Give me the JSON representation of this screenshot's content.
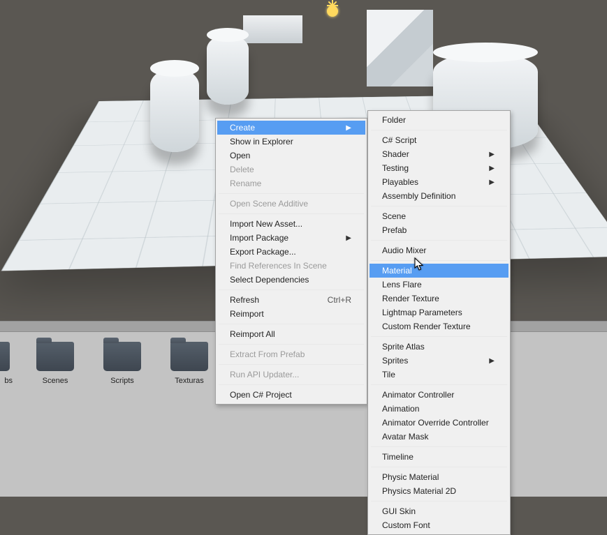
{
  "menu1": {
    "items": [
      {
        "label": "Create",
        "submenu": true,
        "highlight": true
      },
      {
        "label": "Show in Explorer"
      },
      {
        "label": "Open"
      },
      {
        "label": "Delete",
        "disabled": true
      },
      {
        "label": "Rename",
        "disabled": true
      },
      {
        "sep": true
      },
      {
        "label": "Open Scene Additive",
        "disabled": true
      },
      {
        "sep": true
      },
      {
        "label": "Import New Asset..."
      },
      {
        "label": "Import Package",
        "submenu": true
      },
      {
        "label": "Export Package..."
      },
      {
        "label": "Find References In Scene",
        "disabled": true
      },
      {
        "label": "Select Dependencies"
      },
      {
        "sep": true
      },
      {
        "label": "Refresh",
        "shortcut": "Ctrl+R"
      },
      {
        "label": "Reimport"
      },
      {
        "sep": true
      },
      {
        "label": "Reimport All"
      },
      {
        "sep": true
      },
      {
        "label": "Extract From Prefab",
        "disabled": true
      },
      {
        "sep": true
      },
      {
        "label": "Run API Updater...",
        "disabled": true
      },
      {
        "sep": true
      },
      {
        "label": "Open C# Project"
      }
    ]
  },
  "menu2": {
    "items": [
      {
        "label": "Folder"
      },
      {
        "sep": true
      },
      {
        "label": "C# Script"
      },
      {
        "label": "Shader",
        "submenu": true
      },
      {
        "label": "Testing",
        "submenu": true
      },
      {
        "label": "Playables",
        "submenu": true
      },
      {
        "label": "Assembly Definition"
      },
      {
        "sep": true
      },
      {
        "label": "Scene"
      },
      {
        "label": "Prefab"
      },
      {
        "sep": true
      },
      {
        "label": "Audio Mixer"
      },
      {
        "sep": true
      },
      {
        "label": "Material",
        "highlight": true
      },
      {
        "label": "Lens Flare"
      },
      {
        "label": "Render Texture"
      },
      {
        "label": "Lightmap Parameters"
      },
      {
        "label": "Custom Render Texture"
      },
      {
        "sep": true
      },
      {
        "label": "Sprite Atlas"
      },
      {
        "label": "Sprites",
        "submenu": true
      },
      {
        "label": "Tile"
      },
      {
        "sep": true
      },
      {
        "label": "Animator Controller"
      },
      {
        "label": "Animation"
      },
      {
        "label": "Animator Override Controller"
      },
      {
        "label": "Avatar Mask"
      },
      {
        "sep": true
      },
      {
        "label": "Timeline"
      },
      {
        "sep": true
      },
      {
        "label": "Physic Material"
      },
      {
        "label": "Physics Material 2D"
      },
      {
        "sep": true
      },
      {
        "label": "GUI Skin"
      },
      {
        "label": "Custom Font"
      }
    ]
  },
  "folders": [
    {
      "label": "bs"
    },
    {
      "label": "Scenes"
    },
    {
      "label": "Scripts"
    },
    {
      "label": "Texturas"
    }
  ]
}
